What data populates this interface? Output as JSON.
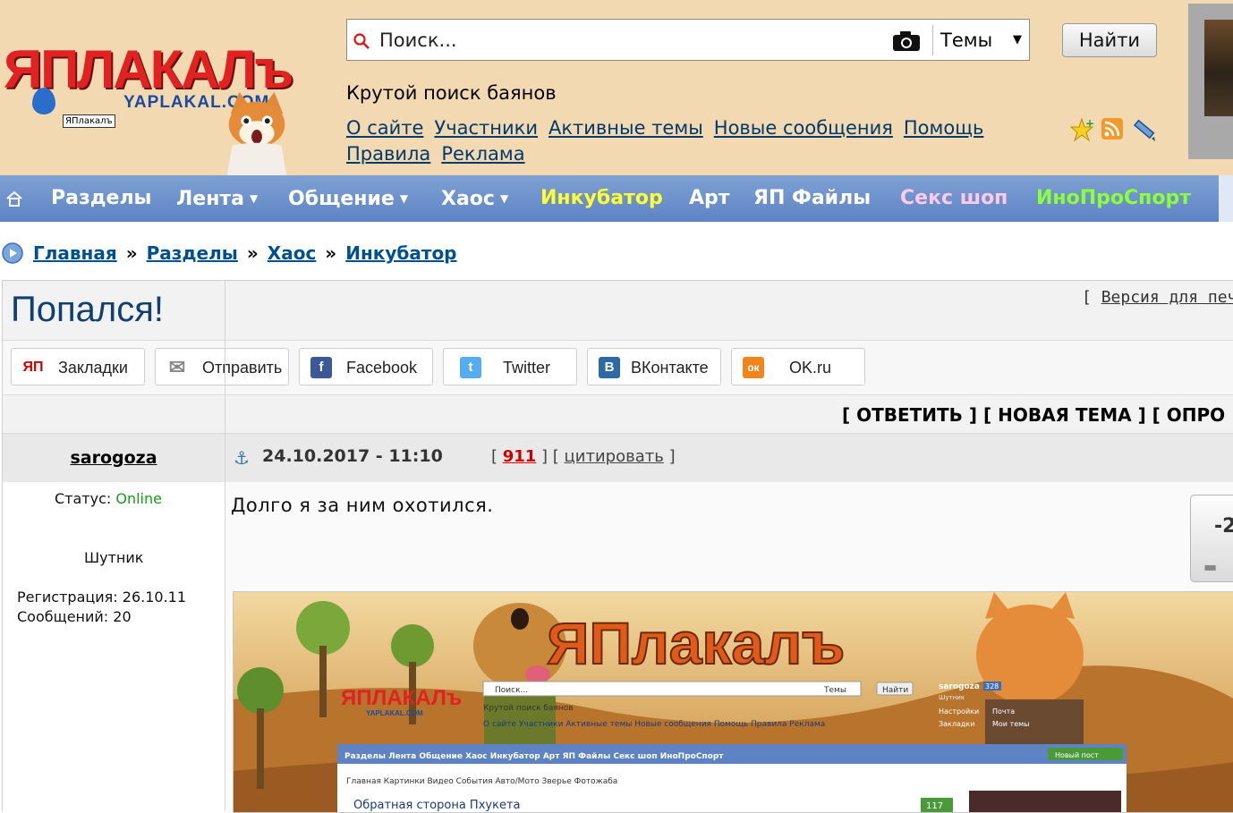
{
  "logo": {
    "title": "ЯПЛАКАЛъ",
    "site": "YAPLAKAL.COM",
    "caption": "ЯПлакалъ"
  },
  "search": {
    "placeholder": "Поиск...",
    "scope": "Темы",
    "find_label": "Найти",
    "tagline": "Крутой поиск баянов"
  },
  "top_links": [
    "О сайте",
    "Участники",
    "Активные темы",
    "Новые сообщения",
    "Помощь",
    "Правила",
    "Реклама"
  ],
  "nav": [
    {
      "label": "Разделы",
      "caret": false,
      "color": "#ffffff"
    },
    {
      "label": "Лента",
      "caret": true,
      "color": "#ffffff"
    },
    {
      "label": "Общение",
      "caret": true,
      "color": "#ffffff"
    },
    {
      "label": "Хаос",
      "caret": true,
      "color": "#ffffff"
    },
    {
      "label": "Инкубатор",
      "caret": false,
      "color": "#ffff33"
    },
    {
      "label": "Арт",
      "caret": false,
      "color": "#ffffff"
    },
    {
      "label": "ЯП Файлы",
      "caret": false,
      "color": "#ffffff"
    },
    {
      "label": "Секс шоп",
      "caret": false,
      "color": "#ffc9e8"
    },
    {
      "label": "ИноПроСпорт",
      "caret": false,
      "color": "#8cff3a"
    }
  ],
  "breadcrumb": {
    "items": [
      "Главная",
      "Разделы",
      "Хаос",
      "Инкубатор"
    ],
    "separator": "»"
  },
  "topic": {
    "title": "Попался!",
    "print_prefix": "[ ",
    "print_link": "Версия для печа"
  },
  "share": [
    {
      "label": "Закладки",
      "icon": "ЯП",
      "color": "#ffffff",
      "fg": "#cc0000"
    },
    {
      "label": "Отправить",
      "icon": "✉",
      "color": "#ffffff",
      "fg": "#777777"
    },
    {
      "label": "Facebook",
      "icon": "f",
      "color": "#3b5998",
      "fg": "#ffffff"
    },
    {
      "label": "Twitter",
      "icon": "t",
      "color": "#55acee",
      "fg": "#ffffff"
    },
    {
      "label": "ВКонтакте",
      "icon": "В",
      "color": "#2d6aa5",
      "fg": "#ffffff"
    },
    {
      "label": "OK.ru",
      "icon": "ок",
      "color": "#f2841c",
      "fg": "#ffffff"
    }
  ],
  "actions": "[ ОТВЕТИТЬ ] [ НОВАЯ ТЕМА ] [ ОПРО",
  "post": {
    "author": "sarogoza",
    "date": "24.10.2017 - 11:10",
    "rating": "911",
    "quote_label": "цитировать",
    "status_label": "Статус: ",
    "status_value": "Online",
    "rank": "Шутник",
    "registration": "Регистрация: 26.10.11",
    "messages": "Сообщений: 20",
    "text": "Долго я за ним охотился.",
    "vote": "-2"
  },
  "embedded": {
    "banner": "ЯПлакалъ",
    "logo": "ЯПЛАКАЛъ",
    "logo_site": "YAPLAKAL.COM",
    "search_placeholder": "Поиск...",
    "scope": "Темы",
    "find": "Найти",
    "tagline": "Крутой поиск баянов",
    "links": "О сайте  Участники  Активные темы  Новые сообщения  Помощь  Правила  Реклама",
    "user": "sarogoza",
    "user_count": "328",
    "user_sub": "Шутник",
    "user_links": [
      "Настройки",
      "Почта",
      "Закладки",
      "Мои темы"
    ],
    "nav": "Разделы  Лента  Общение  Хаос  Инкубатор  Арт  ЯП Файлы  Секс шоп  ИноПроСпорт",
    "new_post": "Новый пост",
    "tabs": "Главная  Картинки  Видео  События  Авто/Мото  Зверье  Фотожаба",
    "headline": "Обратная сторона Пхукета",
    "badge": "117"
  },
  "colors": {
    "header_bg": "#f3d9b1",
    "nav_bg": "#6a8fca",
    "link": "#003a6c",
    "online": "#1a9a1a"
  }
}
